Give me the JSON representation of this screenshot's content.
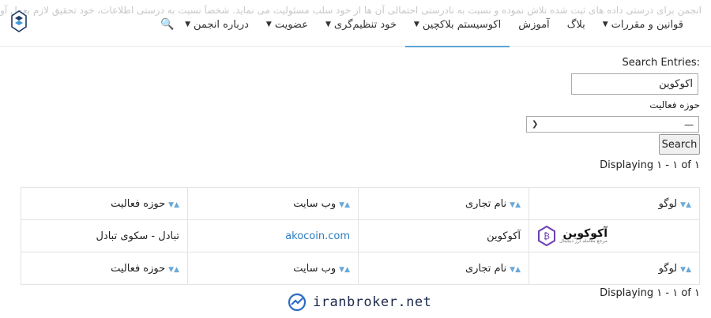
{
  "header": {
    "notice": "انجمن برای درستی داده های ثبت شده تلاش نموده و نسبت به نادرستی احتمالی آن ها از خود سلب مسئولیت می نماید. شخصاً نسبت به درستی اطلاعات، خود تحقیق لازم بعمل آورید",
    "nav": [
      {
        "label": "درباره انجمن",
        "caret": true
      },
      {
        "label": "عضویت",
        "caret": true
      },
      {
        "label": "خود تنظیم‌گری",
        "caret": true
      },
      {
        "label": "اکوسیستم بلاکچین",
        "caret": true,
        "active": true
      },
      {
        "label": "آموزش",
        "caret": false
      },
      {
        "label": "بلاگ",
        "caret": false
      },
      {
        "label": "قوانین و مقررات",
        "caret": true
      }
    ]
  },
  "search": {
    "label": "Search Entries:",
    "value": "آکوکوین",
    "field_label": "حوزه فعالیت",
    "select_value": "—",
    "button": "Search"
  },
  "displaying": "Displaying ۱ - ۱ of ۱",
  "table": {
    "columns": [
      "لوگو",
      "نام تجاری",
      "وب سایت",
      "حوزه فعالیت"
    ],
    "row": {
      "logo_text": "آکوکوین",
      "logo_sub": "مرجع معامله ارز دیجیتال",
      "name": "آکوکوین",
      "website": "akocoin.com",
      "activity": "تبادل - سکوی تبادل"
    }
  },
  "watermark": "iranbroker.net",
  "colors": {
    "accent": "#2d7cc0",
    "sort_arrow": "#6aa9d8",
    "active_underline": "#5aa4d8"
  }
}
